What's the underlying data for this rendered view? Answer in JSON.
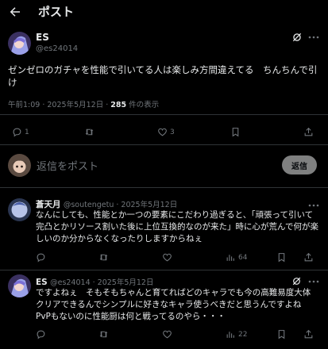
{
  "header": {
    "title": "ポスト"
  },
  "main_post": {
    "name": "ES",
    "handle": "@es24014",
    "text": "ゼンゼロのガチャを性能で引いてる人は楽しみ方間違えてる　ちんちんで引け",
    "time": "午前1:09 · 2025年5月12日 · ",
    "views": "285",
    "views_label": " 件の表示",
    "replies": "1",
    "likes": "3"
  },
  "composer": {
    "placeholder": "返信をポスト",
    "button": "返信"
  },
  "replies": [
    {
      "name": "蒼天月",
      "handle": "@soutengetu · 2025年5月12日",
      "text": "なんにしても、性能とか一つの要素にこだわり過ぎると、「頑張って引いて完凸とかリソース割いた後に上位互換的なのが来た」時に心が荒んで何が楽しいのか分からなくなったりしますからねぇ",
      "views": "64"
    },
    {
      "name": "ES",
      "handle": "@es24014 · 2025年5月12日",
      "text": "ですよねぇ　そもそもちゃんと育てればどのキャラでも今の高難易度大体クリアできるんでシンプルに好きなキャラ使うべきだと思うんですよね　PvPもないのに性能厨は何と戦ってるのやら・・・",
      "views": "22"
    }
  ],
  "colors": {
    "background": "#000000",
    "text": "#e7e9ea",
    "muted": "#71767b",
    "divider": "#2f3336"
  },
  "icons": [
    "back-arrow-icon",
    "grok-icon",
    "more-icon",
    "reply-icon",
    "repost-icon",
    "like-icon",
    "bookmark-icon",
    "share-icon",
    "views-icon"
  ]
}
